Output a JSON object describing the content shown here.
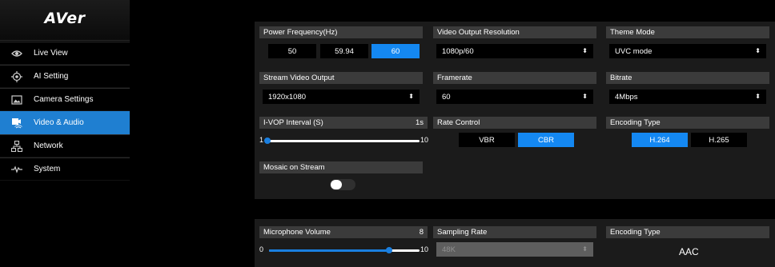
{
  "app": {
    "logo": "AVer"
  },
  "sidebar": {
    "items": [
      {
        "label": "Live View",
        "icon": "eye-icon",
        "active": false
      },
      {
        "label": "AI Setting",
        "icon": "ai-target-icon",
        "active": false
      },
      {
        "label": "Camera Settings",
        "icon": "camera-image-icon",
        "active": false
      },
      {
        "label": "Video & Audio",
        "icon": "video-audio-icon",
        "active": true
      },
      {
        "label": "Network",
        "icon": "network-icon",
        "active": false
      },
      {
        "label": "System",
        "icon": "pulse-icon",
        "active": false
      }
    ]
  },
  "video": {
    "power_frequency": {
      "title": "Power Frequency(Hz)",
      "options": [
        "50",
        "59.94",
        "60"
      ],
      "selected": "60"
    },
    "output_resolution": {
      "title": "Video Output Resolution",
      "value": "1080p/60"
    },
    "theme_mode": {
      "title": "Theme Mode",
      "value": "UVC mode"
    },
    "stream_output": {
      "title": "Stream Video Output",
      "value": "1920x1080"
    },
    "framerate": {
      "title": "Framerate",
      "value": "60"
    },
    "bitrate": {
      "title": "Bitrate",
      "value": "4Mbps"
    },
    "ivop": {
      "title": "I-VOP Interval (S)",
      "value_label": "1s",
      "min": "1",
      "max": "10",
      "value": 1
    },
    "rate_control": {
      "title": "Rate Control",
      "options": [
        "VBR",
        "CBR"
      ],
      "selected": "CBR"
    },
    "encoding": {
      "title": "Encoding Type",
      "options": [
        "H.264",
        "H.265"
      ],
      "selected": "H.264"
    },
    "mosaic": {
      "title": "Mosaic on Stream",
      "enabled": false
    }
  },
  "audio": {
    "mic_volume": {
      "title": "Microphone Volume",
      "value_label": "8",
      "min": "0",
      "max": "10",
      "value": 8
    },
    "sampling_rate": {
      "title": "Sampling Rate",
      "value": "48K"
    },
    "encoding": {
      "title": "Encoding Type",
      "value": "AAC"
    }
  },
  "colors": {
    "accent": "#1488f2",
    "active_nav": "#1f7fd1",
    "panel": "#1b1b1b",
    "header": "#3b3b3b"
  }
}
